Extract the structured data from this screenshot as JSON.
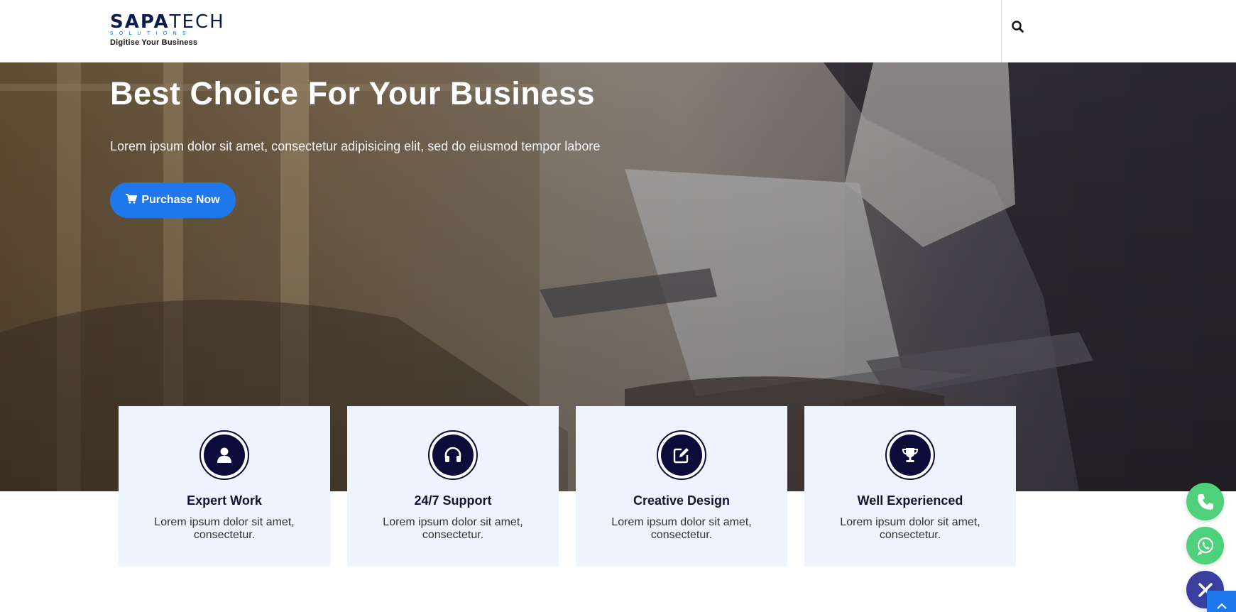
{
  "header": {
    "logo": {
      "word_bold": "SAPA",
      "word_light": "TECH",
      "sub": "SOLUTIONS",
      "tagline": "Digitise Your Business"
    },
    "search_icon": "search-icon"
  },
  "hero": {
    "title": "Best Choice For Your Business",
    "subtitle": "Lorem ipsum dolor sit amet, consectetur adipisicing elit, sed do eiusmod tempor labore",
    "cta_label": "Purchase Now",
    "cta_icon": "cart-icon"
  },
  "features": [
    {
      "icon": "user-icon",
      "title": "Expert Work",
      "text": "Lorem ipsum dolor sit amet, consectetur."
    },
    {
      "icon": "headphones-icon",
      "title": "24/7 Support",
      "text": "Lorem ipsum dolor sit amet, consectetur."
    },
    {
      "icon": "edit-icon",
      "title": "Creative Design",
      "text": "Lorem ipsum dolor sit amet, consectetur."
    },
    {
      "icon": "trophy-icon",
      "title": "Well Experienced",
      "text": "Lorem ipsum dolor sit amet, consectetur."
    }
  ],
  "floating": {
    "phone_icon": "phone-icon",
    "whatsapp_icon": "whatsapp-icon",
    "close_icon": "close-icon",
    "scroll_top_icon": "chevron-up-icon"
  },
  "colors": {
    "accent": "#1e78ec",
    "navy": "#0b0c3a",
    "card_bg": "#eef4fd",
    "green": "#4ed17a",
    "indigo": "#3a3f9e"
  }
}
